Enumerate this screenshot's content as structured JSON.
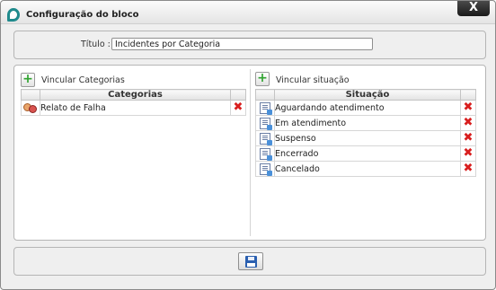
{
  "window": {
    "title": "Configuração do bloco",
    "close_label": "X"
  },
  "form": {
    "title_label": "Título :",
    "title_value": "Incidentes por Categoria"
  },
  "categories_panel": {
    "add_label": "Vincular Categorias",
    "header": "Categorias",
    "rows": [
      {
        "label": "Relato de Falha",
        "icon": "people-icon"
      }
    ]
  },
  "situations_panel": {
    "add_label": "Vincular situação",
    "header": "Situação",
    "rows": [
      {
        "label": "Aguardando atendimento",
        "icon": "document-icon"
      },
      {
        "label": "Em atendimento",
        "icon": "document-icon"
      },
      {
        "label": "Suspenso",
        "icon": "document-icon"
      },
      {
        "label": "Encerrado",
        "icon": "document-icon"
      },
      {
        "label": "Cancelado",
        "icon": "document-icon"
      }
    ]
  },
  "footer": {
    "save_icon": "floppy-disk-icon"
  },
  "colors": {
    "accent": "#1f8a8c",
    "delete": "#d81e1e",
    "add": "#2ea32e"
  }
}
